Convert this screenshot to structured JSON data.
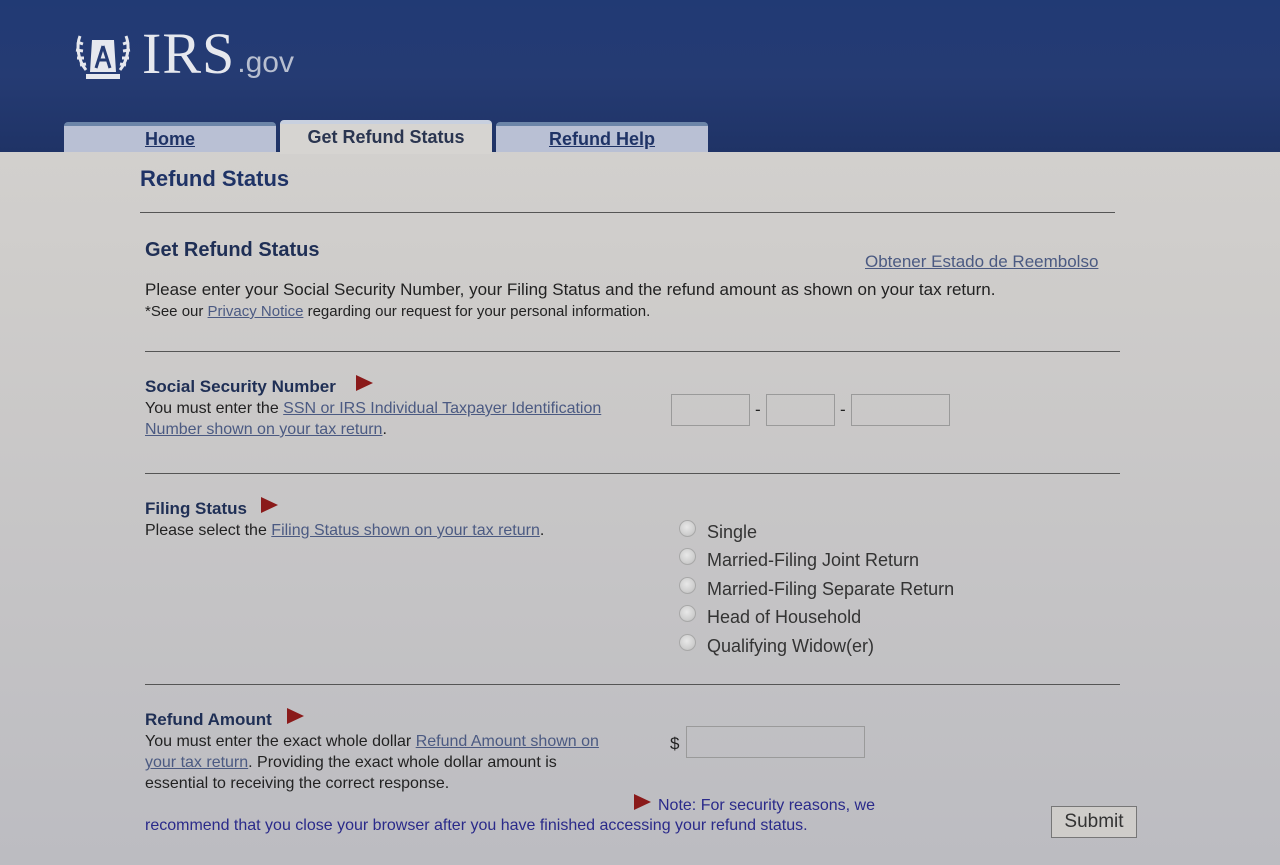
{
  "header": {
    "logo_text": "IRS",
    "logo_suffix": ".gov",
    "tabs": [
      {
        "label": "Home"
      },
      {
        "label": "Get Refund Status"
      },
      {
        "label": "Refund Help"
      }
    ]
  },
  "page_title": "Refund Status",
  "section": {
    "title": "Get Refund Status",
    "spanish_link": "Obtener Estado de Reembolso",
    "intro": "Please enter your Social Security Number, your Filing Status and the refund amount as shown on your tax return.",
    "privacy_prefix": "*See our ",
    "privacy_link": "Privacy Notice",
    "privacy_suffix": " regarding our request for your personal information."
  },
  "ssn": {
    "label": "Social Security Number",
    "help_prefix": "You must enter the ",
    "help_link_line1": "SSN or IRS Individual Taxpayer Identification",
    "help_link_line2": "Number shown on your tax return",
    "help_suffix": ".",
    "separator": "-",
    "part1_value": "",
    "part2_value": "",
    "part3_value": ""
  },
  "filing_status": {
    "label": "Filing Status",
    "help_prefix": "Please select the ",
    "help_link": "Filing Status shown on your tax return",
    "help_suffix": ".",
    "options": [
      {
        "label": "Single",
        "selected": false
      },
      {
        "label": "Married-Filing Joint Return",
        "selected": false
      },
      {
        "label": "Married-Filing Separate Return",
        "selected": false
      },
      {
        "label": "Head of Household",
        "selected": false
      },
      {
        "label": "Qualifying Widow(er)",
        "selected": false
      }
    ]
  },
  "refund_amount": {
    "label": "Refund Amount",
    "help_prefix": "You must enter the exact whole dollar ",
    "help_link_line1": "Refund Amount shown on",
    "help_link_line2": "your tax return",
    "help_suffix_line2": ". Providing the exact whole dollar amount is",
    "help_line3": "essential to receiving the correct response.",
    "currency": "$",
    "value": ""
  },
  "note": {
    "line1": "Note: For security reasons, we",
    "line2": "recommend that you close your browser after you have finished accessing your refund status."
  },
  "submit_label": "Submit",
  "colors": {
    "header_bg": "#213a74",
    "accent_arrow": "#8a1a1a",
    "link": "#4b5a82",
    "heading": "#1f3366"
  }
}
